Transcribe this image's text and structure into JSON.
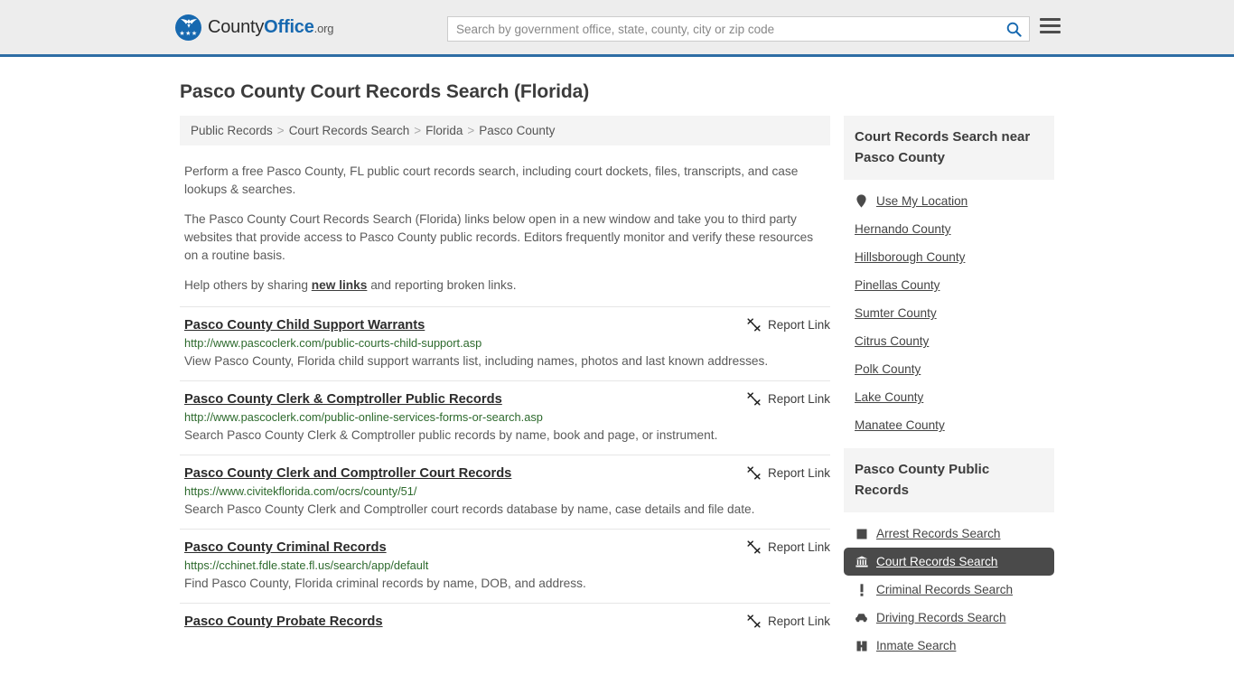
{
  "header": {
    "logo": {
      "county": "County",
      "office": "Office",
      "tld": ".org",
      "icon": "eagle-seal-icon"
    },
    "search": {
      "placeholder": "Search by government office, state, county, city or zip code",
      "value": "",
      "icon": "search-icon"
    },
    "menu_icon": "hamburger-menu-icon",
    "border_color": "#2e6da4",
    "background": "#ededed"
  },
  "page_title": "Pasco County Court Records Search (Florida)",
  "breadcrumb": {
    "separator": ">",
    "items": [
      {
        "label": "Public Records"
      },
      {
        "label": "Court Records Search"
      },
      {
        "label": "Florida"
      },
      {
        "label": "Pasco County"
      }
    ]
  },
  "intro": {
    "p1": "Perform a free Pasco County, FL public court records search, including court dockets, files, transcripts, and case lookups & searches.",
    "p2": "The Pasco County Court Records Search (Florida) links below open in a new window and take you to third party websites that provide access to Pasco County public records. Editors frequently monitor and verify these resources on a routine basis.",
    "p3_before": "Help others by sharing ",
    "p3_link": "new links",
    "p3_after": " and reporting broken links."
  },
  "report_link_label": "Report Link",
  "report_link_icon": "broken-link-icon",
  "results": [
    {
      "title": "Pasco County Child Support Warrants",
      "url": "http://www.pascoclerk.com/public-courts-child-support.asp",
      "description": "View Pasco County, Florida child support warrants list, including names, photos and last known addresses."
    },
    {
      "title": "Pasco County Clerk & Comptroller Public Records",
      "url": "http://www.pascoclerk.com/public-online-services-forms-or-search.asp",
      "description": "Search Pasco County Clerk & Comptroller public records by name, book and page, or instrument."
    },
    {
      "title": "Pasco County Clerk and Comptroller Court Records",
      "url": "https://www.civitekflorida.com/ocrs/county/51/",
      "description": "Search Pasco County Clerk and Comptroller court records database by name, case details and file date."
    },
    {
      "title": "Pasco County Criminal Records",
      "url": "https://cchinet.fdle.state.fl.us/search/app/default",
      "description": "Find Pasco County, Florida criminal records by name, DOB, and address."
    },
    {
      "title": "Pasco County Probate Records",
      "url": "",
      "description": ""
    }
  ],
  "sidebar": {
    "near_panel": {
      "title": "Court Records Search near Pasco County",
      "items": [
        {
          "label": "Use My Location",
          "icon": "map-pin-icon",
          "active": false
        },
        {
          "label": "Hernando County",
          "icon": "",
          "active": false
        },
        {
          "label": "Hillsborough County",
          "icon": "",
          "active": false
        },
        {
          "label": "Pinellas County",
          "icon": "",
          "active": false
        },
        {
          "label": "Sumter County",
          "icon": "",
          "active": false
        },
        {
          "label": "Citrus County",
          "icon": "",
          "active": false
        },
        {
          "label": "Polk County",
          "icon": "",
          "active": false
        },
        {
          "label": "Lake County",
          "icon": "",
          "active": false
        },
        {
          "label": "Manatee County",
          "icon": "",
          "active": false
        }
      ]
    },
    "public_records_panel": {
      "title": "Pasco County Public Records",
      "items": [
        {
          "label": "Arrest Records Search",
          "icon": "square-icon",
          "active": false
        },
        {
          "label": "Court Records Search",
          "icon": "courthouse-icon",
          "active": true
        },
        {
          "label": "Criminal Records Search",
          "icon": "exclamation-icon",
          "active": false
        },
        {
          "label": "Driving Records Search",
          "icon": "car-icon",
          "active": false
        },
        {
          "label": "Inmate Search",
          "icon": "jail-icon",
          "active": false
        }
      ]
    }
  }
}
